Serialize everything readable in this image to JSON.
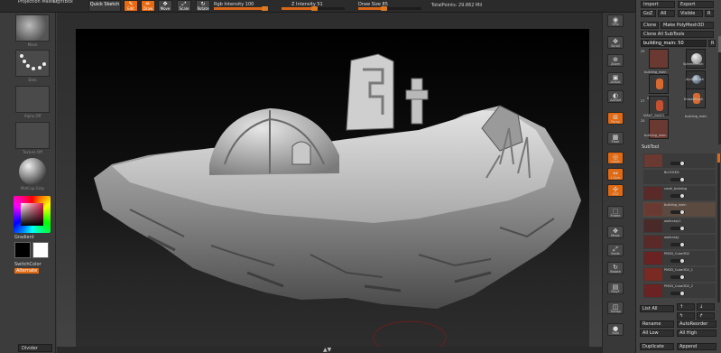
{
  "menu": {
    "projection_master": "Projection Master",
    "lightbox": "LightBox"
  },
  "mode_buttons": [
    {
      "label": "Edit",
      "active": true
    },
    {
      "label": "Draw",
      "active": true
    },
    {
      "label": "Move",
      "active": false
    },
    {
      "label": "Scale",
      "active": false
    },
    {
      "label": "Rotate",
      "active": false
    }
  ],
  "quick_sketch": "Quick Sketch",
  "sliders": {
    "rgb_intensity": {
      "label": "Rgb Intensity",
      "value": "100",
      "fraction": 1.0
    },
    "z_intensity": {
      "label": "Z Intensity",
      "value": "51",
      "fraction": 0.51
    },
    "draw_size": {
      "label": "Draw Size",
      "value": "85",
      "fraction": 0.4
    }
  },
  "total_points": "TotalPoints: 29.862 Mil",
  "left_shelf": {
    "brush_caption": "Move",
    "stroke_caption": "Dots",
    "alpha_caption": "Alpha Off",
    "texture_caption": "Texture Off",
    "material_caption": "MatCap Gray",
    "gradient": "Gradient",
    "switch_color": "SwitchColor",
    "alternate": "Alternate",
    "divider": "Divider"
  },
  "right_shelf": [
    {
      "label": "SPix",
      "icon": "spix-icon",
      "orange": false
    },
    {
      "label": "Scroll",
      "icon": "scroll-icon",
      "orange": false
    },
    {
      "label": "Zoom",
      "icon": "zoom-icon",
      "orange": false
    },
    {
      "label": "Actual",
      "icon": "actual-icon",
      "orange": false
    },
    {
      "label": "AAHalf",
      "icon": "aahalf-icon",
      "orange": false
    },
    {
      "label": "Persp",
      "icon": "perspective-icon",
      "orange": true
    },
    {
      "label": "Floor",
      "icon": "floor-icon",
      "orange": false
    },
    {
      "label": "Local",
      "icon": "local-icon",
      "orange": true
    },
    {
      "label": "L.Sym",
      "icon": "local-symmetry-icon",
      "orange": true
    },
    {
      "label": "XYZ",
      "icon": "xyz-icon",
      "orange": true
    },
    {
      "label": "Frame",
      "icon": "frame-icon",
      "orange": false
    },
    {
      "label": "Move",
      "icon": "move-icon",
      "orange": false
    },
    {
      "label": "Scale",
      "icon": "scale-icon",
      "orange": false
    },
    {
      "label": "Rotate",
      "icon": "rotate-icon",
      "orange": false
    },
    {
      "label": "PolyF",
      "icon": "polyframe-icon",
      "orange": false
    },
    {
      "label": "Transp",
      "icon": "transparent-icon",
      "orange": false
    },
    {
      "label": "Solo",
      "icon": "solo-icon",
      "orange": false
    }
  ],
  "tool_panel": {
    "import": "Import",
    "export": "Export",
    "goz": "GoZ",
    "all": "All",
    "visible": "Visible",
    "r": "R",
    "clone": "Clone",
    "make_polymesh": "Make PolyMesh3D",
    "clone_all_subtools": "Clone All SubTools",
    "current_tool": "building_main: 50",
    "r2": "R",
    "tools": [
      {
        "label": "building_main",
        "num": "25"
      },
      {
        "label": "SphereBrush",
        "num": ""
      },
      {
        "label": "SimpleBrush",
        "num": ""
      },
      {
        "label": "AlphaBrush",
        "num": ""
      },
      {
        "label": "VIANT_BASE1",
        "num": "27"
      },
      {
        "label": "EraserBrush",
        "num": ""
      },
      {
        "label": "building_main",
        "num": "25"
      },
      {
        "label": "building_main",
        "num": ""
      }
    ],
    "subtool_title": "SubTool",
    "subtools": [
      {
        "name": "",
        "selected": false
      },
      {
        "name": "BLOCKED",
        "selected": false
      },
      {
        "name": "small_building",
        "selected": false
      },
      {
        "name": "building_main",
        "selected": true
      },
      {
        "name": "wallcrazy1",
        "selected": false
      },
      {
        "name": "wallcrazy",
        "selected": false
      },
      {
        "name": "PM3D_Cube3D2",
        "selected": false
      },
      {
        "name": "PM3D_Cube3D2_1",
        "selected": false
      },
      {
        "name": "PM3D_Cube3D2_2",
        "selected": false
      }
    ],
    "list_all": "List All",
    "rename": "Rename",
    "autoreorder": "AutoReorder",
    "all_low": "All Low",
    "all_high": "All High",
    "duplicate": "Duplicate",
    "append": "Append"
  },
  "colors": {
    "accent": "#e86a12",
    "background": "#3a3a3a",
    "canvas": "#000000"
  }
}
